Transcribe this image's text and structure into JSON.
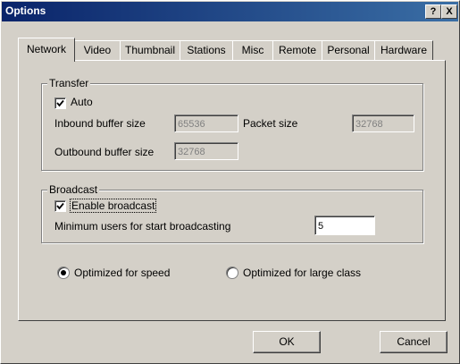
{
  "window": {
    "title": "Options"
  },
  "titlebar_buttons": {
    "help": "?",
    "close": "X"
  },
  "tabs": [
    {
      "label": "Network",
      "active": true
    },
    {
      "label": "Video"
    },
    {
      "label": "Thumbnail"
    },
    {
      "label": "Stations"
    },
    {
      "label": "Misc"
    },
    {
      "label": "Remote"
    },
    {
      "label": "Personal"
    },
    {
      "label": "Hardware"
    }
  ],
  "transfer": {
    "legend": "Transfer",
    "auto_label": "Auto",
    "auto_checked": true,
    "inbound_label": "Inbound buffer size",
    "inbound_value": "65536",
    "packet_label": "Packet size",
    "packet_value": "32768",
    "outbound_label": "Outbound buffer size",
    "outbound_value": "32768"
  },
  "broadcast": {
    "legend": "Broadcast",
    "enable_label": "Enable broadcast",
    "enable_checked": true,
    "min_users_label": "Minimum users for start broadcasting",
    "min_users_value": "5"
  },
  "optimization": {
    "speed_label": "Optimized for speed",
    "speed_selected": true,
    "large_class_label": "Optimized for large class",
    "large_class_selected": false
  },
  "buttons": {
    "ok": "OK",
    "cancel": "Cancel"
  }
}
